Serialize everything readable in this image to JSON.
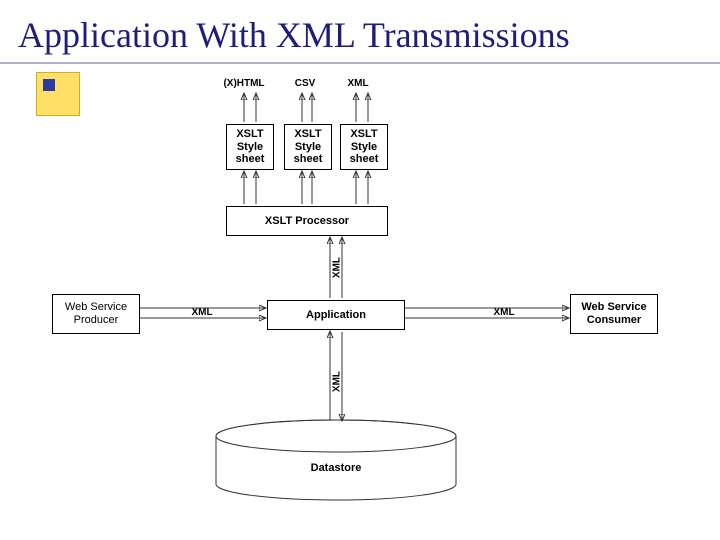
{
  "title": "Application With XML Transmissions",
  "outputs": {
    "xhtml": "(X)HTML",
    "csv": "CSV",
    "xml": "XML"
  },
  "xslt_stylesheet": "XSLT\nStyle\nsheet",
  "xslt_processor": "XSLT Processor",
  "application": "Application",
  "web_service_producer": "Web Service\nProducer",
  "web_service_consumer": "Web Service\nConsumer",
  "datastore": "Datastore",
  "xml_label": "XML"
}
